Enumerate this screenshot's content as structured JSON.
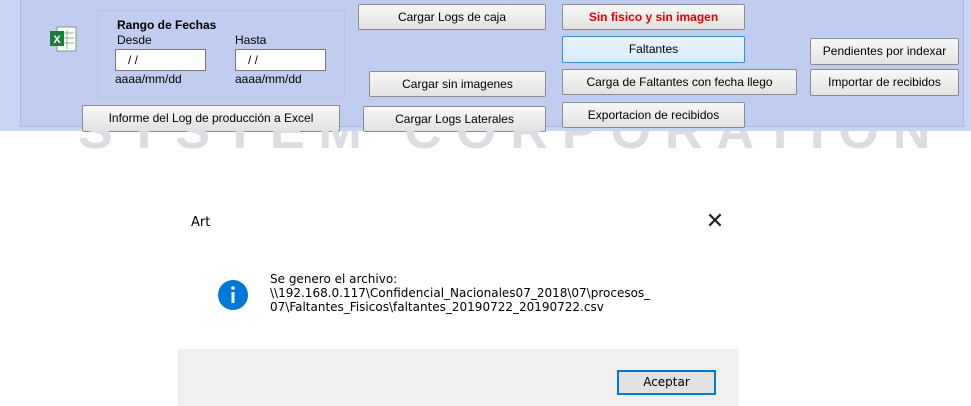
{
  "form": {
    "date_range": {
      "title": "Rango de Fechas",
      "from_label": "Desde",
      "to_label": "Hasta",
      "from_value": "/ /",
      "to_value": "/ /",
      "from_format": "aaaa/mm/dd",
      "to_format": "aaaa/mm/dd"
    },
    "buttons": {
      "informe_excel": "Informe del Log de producción a Excel",
      "cargar_logs_caja": "Cargar Logs de caja",
      "cargar_sin_imagenes": "Cargar sin imagenes",
      "cargar_logs_laterales": "Cargar Logs Laterales",
      "sin_fisico_sin_imagen": "Sin fisico y sin imagen",
      "faltantes": "Faltantes",
      "carga_faltantes_fecha": "Carga de Faltantes con fecha llego",
      "exportacion_recibidos": "Exportacion de recibidos",
      "pendientes_indexar": "Pendientes por indexar",
      "importar_recibidos": "Importar de recibidos"
    },
    "accent_red": "#e00000"
  },
  "watermark": "SYSTEM CORPORATION S.A.",
  "dialog": {
    "title": "Art",
    "close_glyph": "✕",
    "message_lines": [
      "Se genero el archivo:",
      "\\\\192.168.0.117\\Confidencial_Nacionales07_2018\\07\\procesos_",
      "07\\Faltantes_Fisicos\\faltantes_20190722_20190722.csv"
    ],
    "ok_button": "Aceptar",
    "icon": "info-icon",
    "accent": "#0078d7"
  }
}
